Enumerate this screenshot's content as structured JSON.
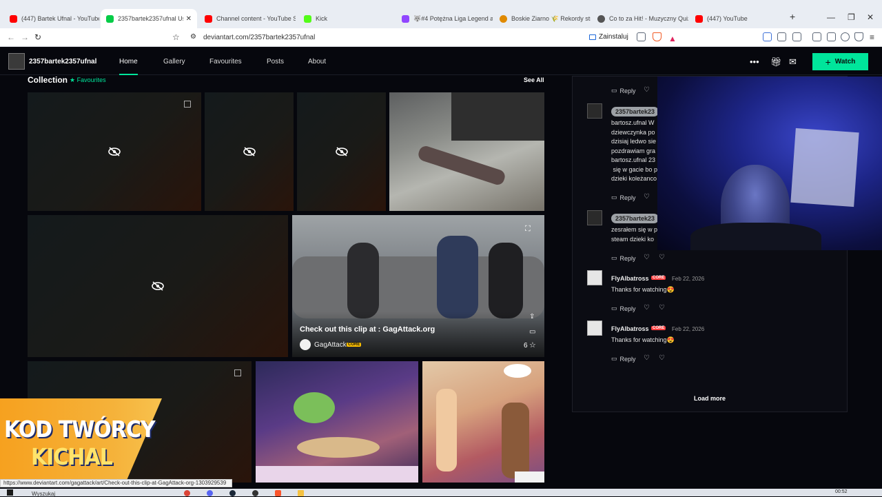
{
  "browser": {
    "tabs": [
      {
        "title": "(447) Bartek Ufnal - YouTube",
        "color": "#ff0000"
      },
      {
        "title": "2357bartek2357ufnal User",
        "color": "#05cc47"
      },
      {
        "title": "Channel content - YouTube St",
        "color": "#ff0000"
      },
      {
        "title": "Kick",
        "color": "#53fc18"
      },
      {
        "title": "🐺#4 Potężna Liga Legend a p",
        "color": "#9146ff"
      },
      {
        "title": "Boskie Ziarno 🌾 Rekordy stre",
        "color": "#e08a00"
      },
      {
        "title": "Co to za Hit! - Muzyczny Quiz",
        "color": "#555555"
      },
      {
        "title": "(447) YouTube",
        "color": "#ff0000"
      }
    ],
    "new_tab": "+",
    "url": "deviantart.com/2357bartek2357ufnal",
    "install_label": "Zainstaluj"
  },
  "site": {
    "username": "2357bartek2357ufnal",
    "nav": [
      "Home",
      "Gallery",
      "Favourites",
      "Posts",
      "About"
    ],
    "watch_label": "Watch",
    "watch_icon": "+"
  },
  "collection": {
    "title": "Collection",
    "subtitle": "Favourites",
    "see_all": "See All",
    "clip_caption": "Check out this clip at : GagAttack.org",
    "clip_author": "GagAttack",
    "core_badge": "CORE",
    "fav_count": "6"
  },
  "promo": {
    "line1": "KOD TWÓRCY",
    "line2": "KICHAL"
  },
  "comments": {
    "reply_label": "Reply",
    "load_more": "Load more",
    "pill_name": "2357bartek23",
    "comment1": "bartosz.ufnal W\ndziewczynka po\ndzisiaj ledwo sie\npozdrawiam gra\nbartosz.ufnal 23\n się w gacie bo p\ndzieki koleżanco",
    "comment2": "zesrałem się w p\nsteam dzieki ko",
    "fly_name": "FlyAlbatross",
    "fly_badge": "CORE",
    "fly_date": "Feb 22, 2026",
    "fly_text": "Thanks for watching😍"
  },
  "status": {
    "link": "https://www.deviantart.com/gagattack/art/Check-out-this-clip-at-GagAttack-org-1303929539"
  },
  "taskbar": {
    "search": "Wyszukaj",
    "time": "00:52"
  }
}
